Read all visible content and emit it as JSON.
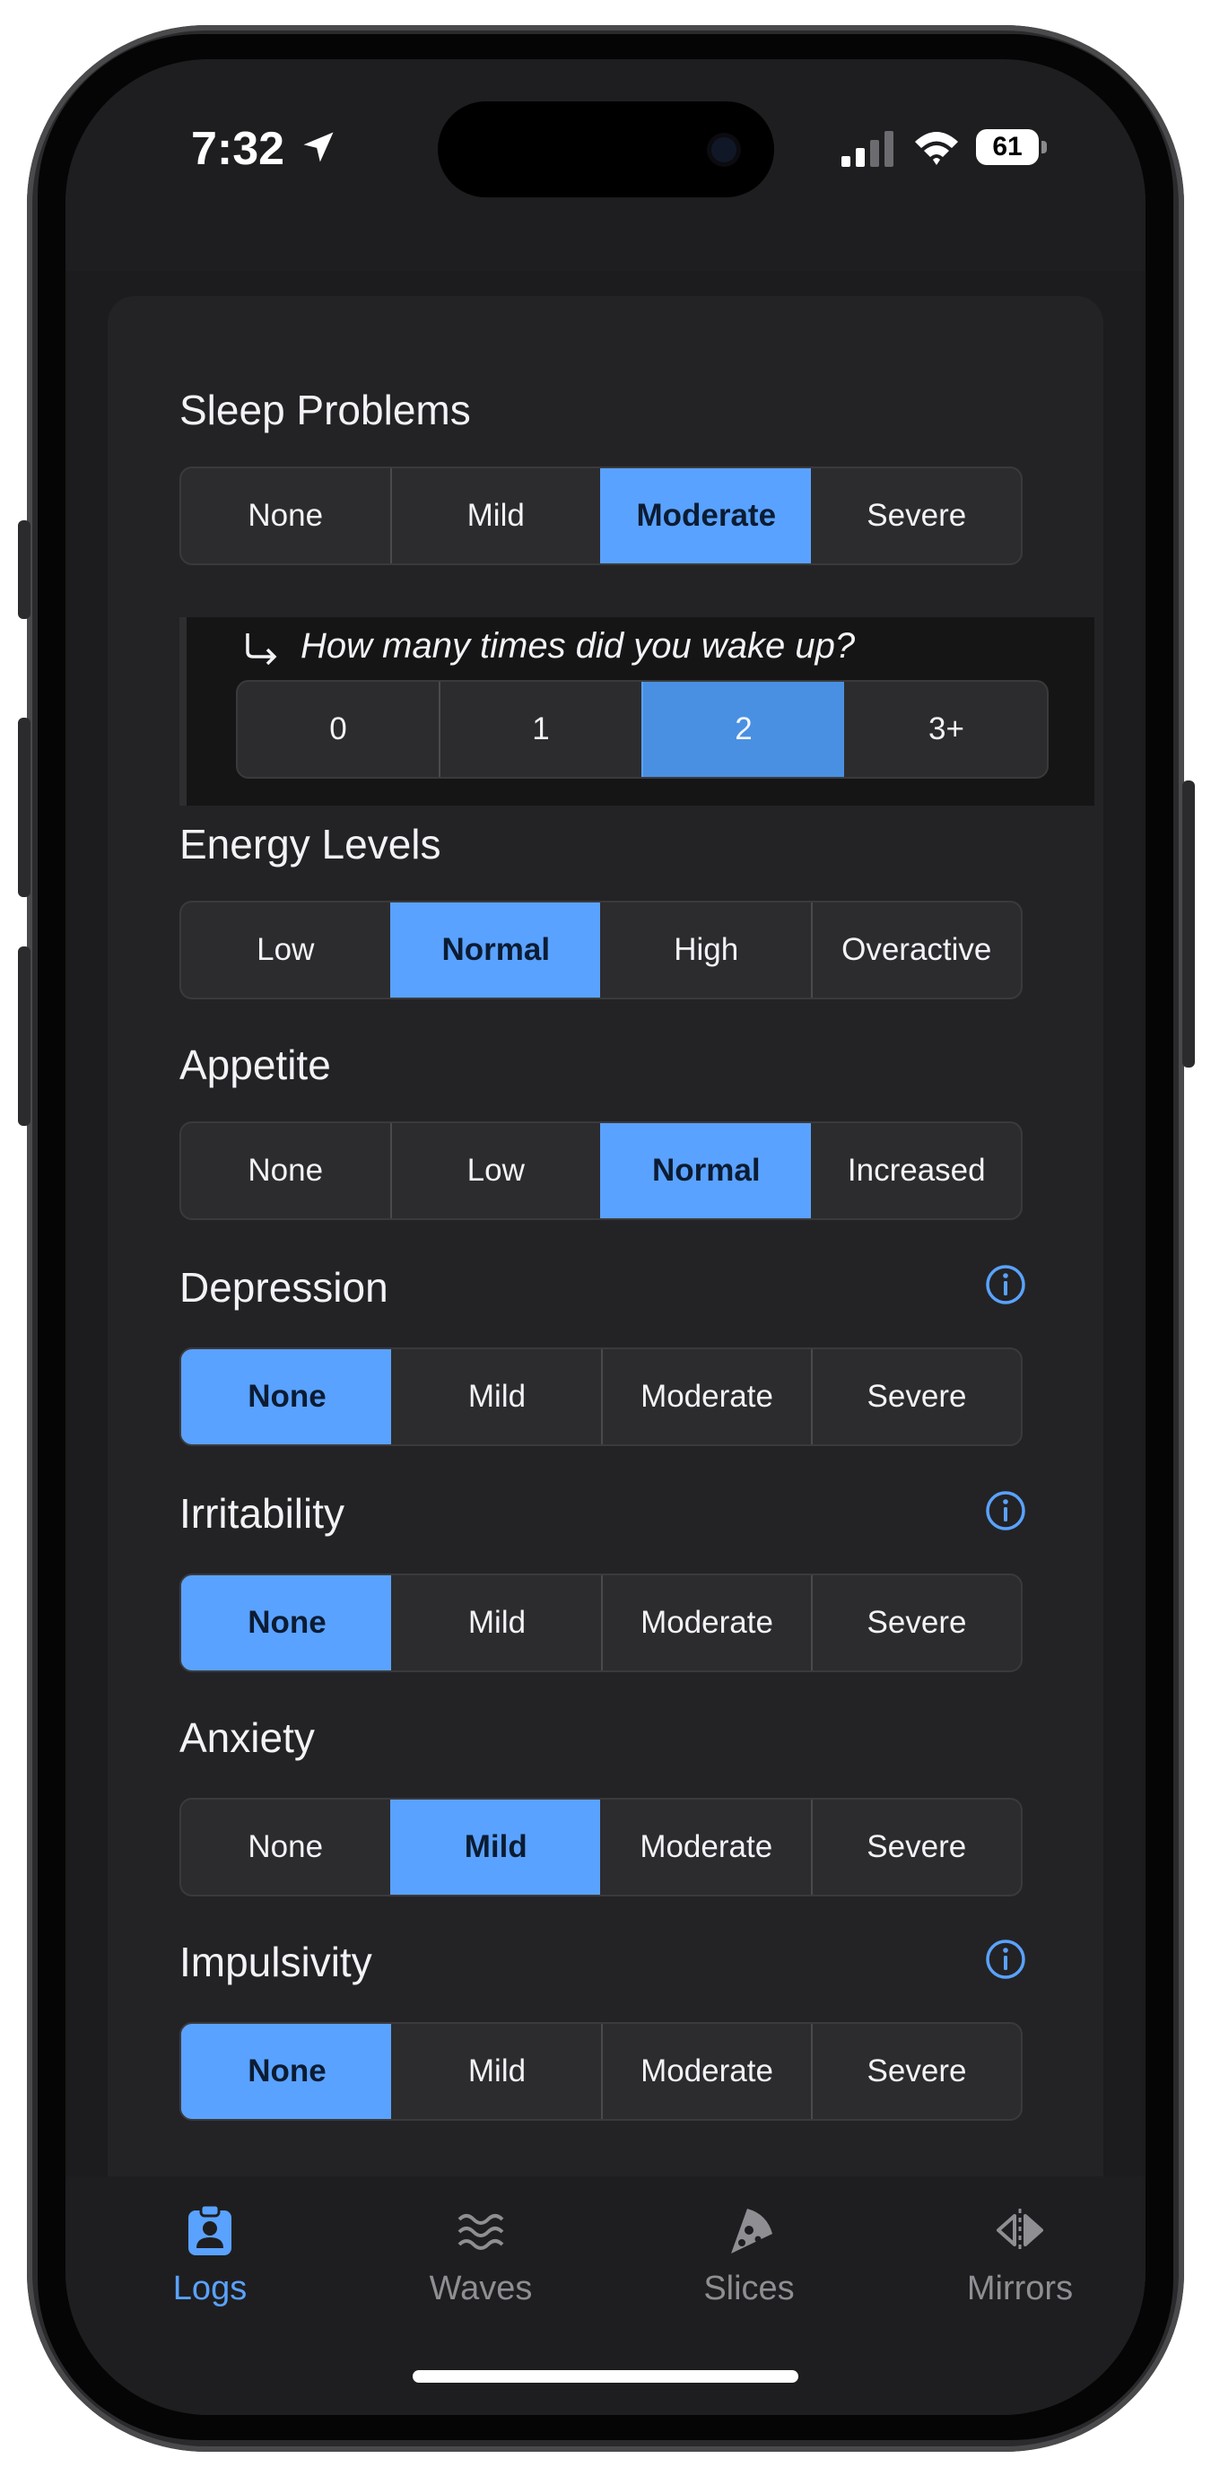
{
  "status_bar": {
    "time": "7:32",
    "battery": "61"
  },
  "sections": [
    {
      "title": "Sleep Problems",
      "options": [
        "None",
        "Mild",
        "Moderate",
        "Severe"
      ],
      "selected": 2,
      "info": false
    },
    {
      "title": "Energy Levels",
      "options": [
        "Low",
        "Normal",
        "High",
        "Overactive"
      ],
      "selected": 1,
      "info": false
    },
    {
      "title": "Appetite",
      "options": [
        "None",
        "Low",
        "Normal",
        "Increased"
      ],
      "selected": 2,
      "info": false
    },
    {
      "title": "Depression",
      "options": [
        "None",
        "Mild",
        "Moderate",
        "Severe"
      ],
      "selected": 0,
      "info": true
    },
    {
      "title": "Irritability",
      "options": [
        "None",
        "Mild",
        "Moderate",
        "Severe"
      ],
      "selected": 0,
      "info": true
    },
    {
      "title": "Anxiety",
      "options": [
        "None",
        "Mild",
        "Moderate",
        "Severe"
      ],
      "selected": 1,
      "info": false
    },
    {
      "title": "Impulsivity",
      "options": [
        "None",
        "Mild",
        "Moderate",
        "Severe"
      ],
      "selected": 0,
      "info": true
    }
  ],
  "sleep_followup": {
    "question": "How many times did you wake up?",
    "options": [
      "0",
      "1",
      "2",
      "3+"
    ],
    "selected": 2
  },
  "tabs": [
    {
      "label": "Logs",
      "icon": "clipboard-person-icon",
      "active": true
    },
    {
      "label": "Waves",
      "icon": "waves-icon",
      "active": false
    },
    {
      "label": "Slices",
      "icon": "pizza-slice-icon",
      "active": false
    },
    {
      "label": "Mirrors",
      "icon": "mirror-triangles-icon",
      "active": false
    }
  ],
  "colors": {
    "accent": "#5aa2ff",
    "background": "#1c1c1e",
    "card": "#232325",
    "segment": "#2c2c2e",
    "inactive_tab": "#8e8e93"
  }
}
